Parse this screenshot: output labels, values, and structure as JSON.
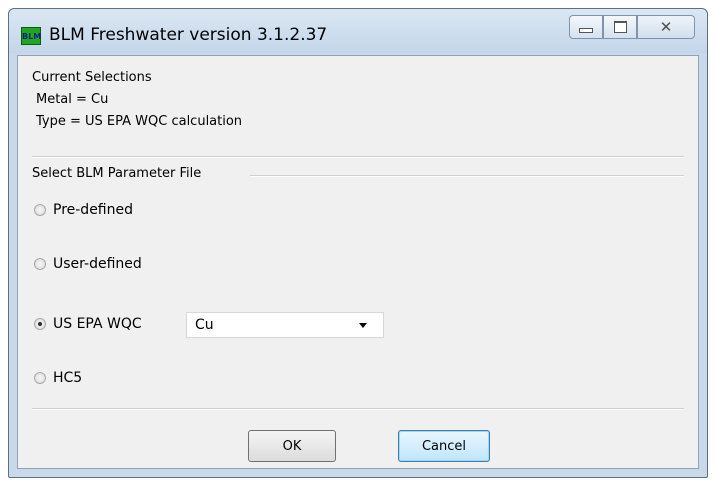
{
  "window": {
    "title": "BLM Freshwater version 3.1.2.37",
    "app_icon_text": "BLM",
    "controls": {
      "minimize": "minimize-icon",
      "maximize": "maximize-icon",
      "close": "close-icon",
      "close_glyph": "✕"
    }
  },
  "current_selections": {
    "heading": "Current Selections",
    "metal": "Metal = Cu",
    "type": "Type = US EPA WQC calculation"
  },
  "parameter_file": {
    "heading": "Select BLM Parameter File",
    "options": [
      {
        "label": "Pre-defined",
        "checked": false
      },
      {
        "label": "User-defined",
        "checked": false
      },
      {
        "label": "US EPA WQC",
        "checked": true
      },
      {
        "label": "HC5",
        "checked": false
      }
    ],
    "wqc_metal_select": {
      "value": "Cu"
    }
  },
  "buttons": {
    "ok": "OK",
    "cancel": "Cancel"
  }
}
